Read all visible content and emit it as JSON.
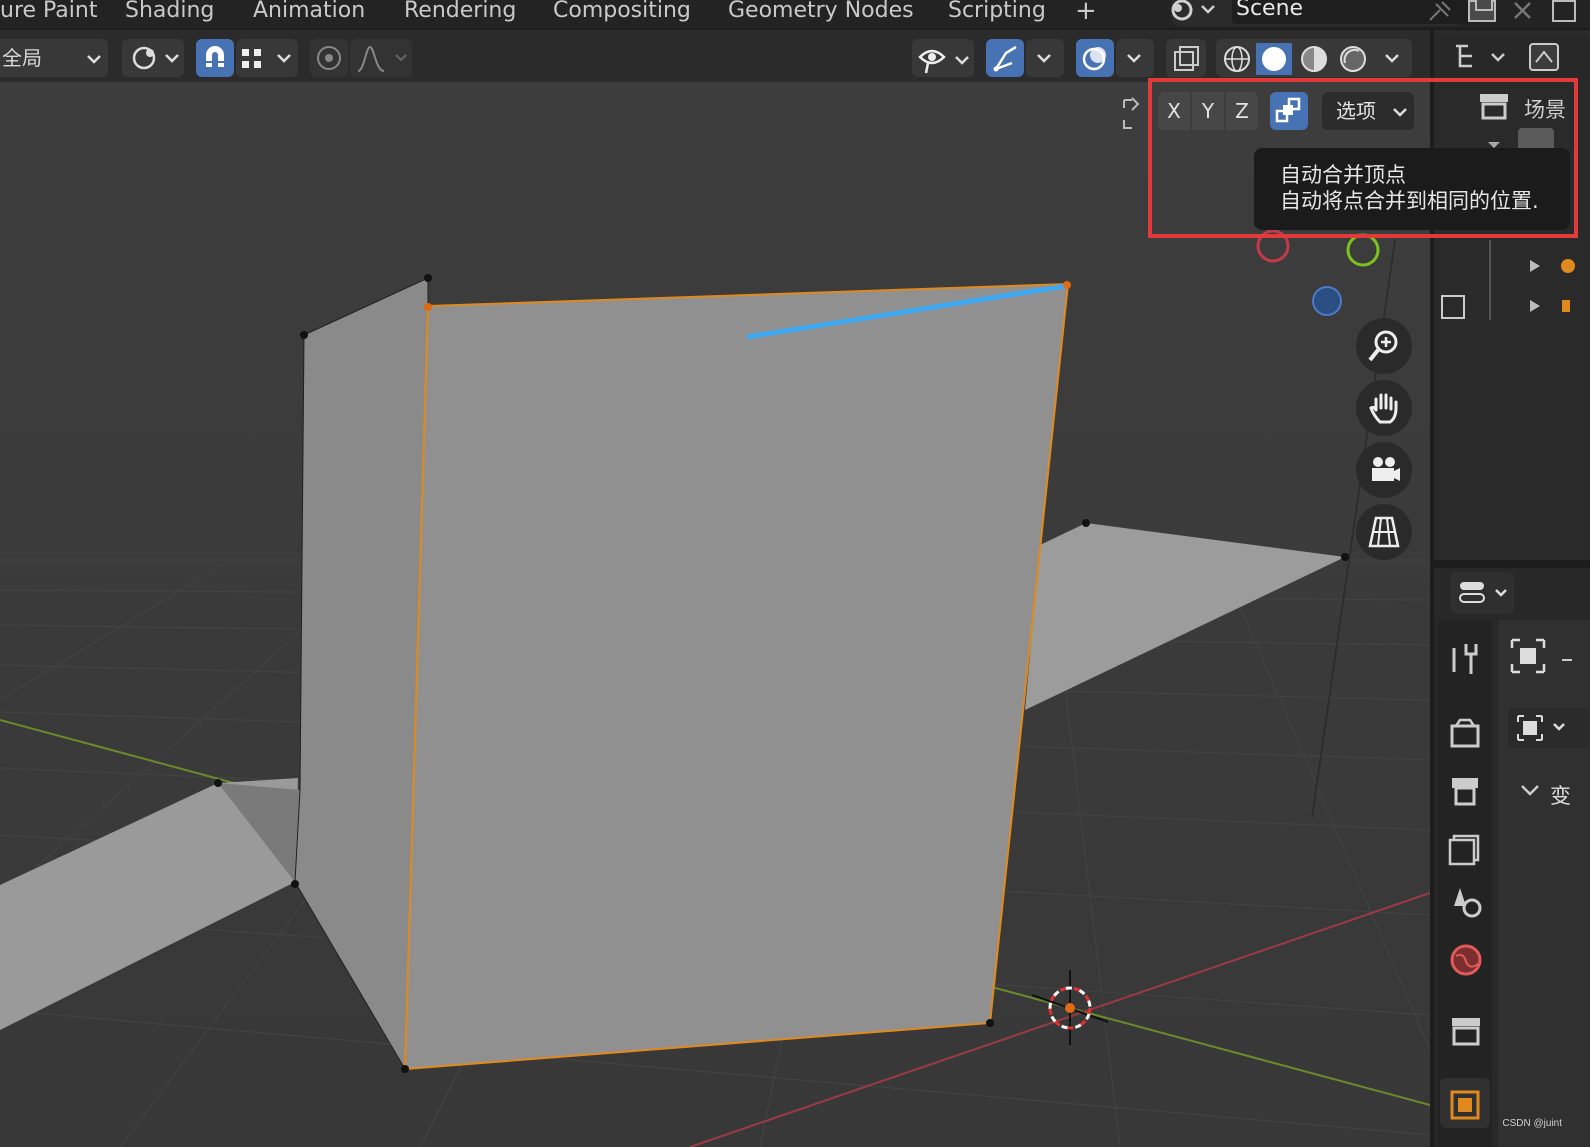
{
  "workspace_tabs": {
    "items": [
      {
        "label": "ure Paint"
      },
      {
        "label": "Shading"
      },
      {
        "label": "Animation"
      },
      {
        "label": "Rendering"
      },
      {
        "label": "Compositing"
      },
      {
        "label": "Geometry Nodes"
      },
      {
        "label": "Scripting"
      }
    ],
    "add_label": "+"
  },
  "scene": {
    "name": "Scene"
  },
  "header": {
    "orientation_label": "全局",
    "pivot_icon": "pivot-icon",
    "snap_icon": "magnet-icon",
    "snap_target_icon": "snap-grid-icon",
    "proportional_icon": "proportional-edit-icon",
    "falloff_icon": "falloff-curve-icon",
    "visibility_icon": "eye-icon",
    "gizmo_icon": "gizmo-icon",
    "overlay_icon": "overlay-icon",
    "xray_icon": "xray-icon",
    "shading_modes": [
      "wireframe",
      "solid",
      "material",
      "rendered"
    ]
  },
  "axis_popover": {
    "x_label": "X",
    "y_label": "Y",
    "z_label": "Z",
    "automerge_icon": "auto-merge-icon",
    "options_label": "选项"
  },
  "tooltip": {
    "title": "自动合并顶点",
    "description": "自动将点合并到相同的位置."
  },
  "outliner": {
    "scene_label": "场景"
  },
  "properties": {
    "section_label": "变",
    "tabs": [
      "tool",
      "render",
      "output",
      "view-layer",
      "scene",
      "world",
      "collection",
      "object"
    ]
  },
  "colors": {
    "accent": "#4772b3",
    "highlight": "#e03a3a",
    "selected_edge": "#e08a1e",
    "selected_line": "#3ea8f0"
  },
  "watermark": "CSDN @juint"
}
